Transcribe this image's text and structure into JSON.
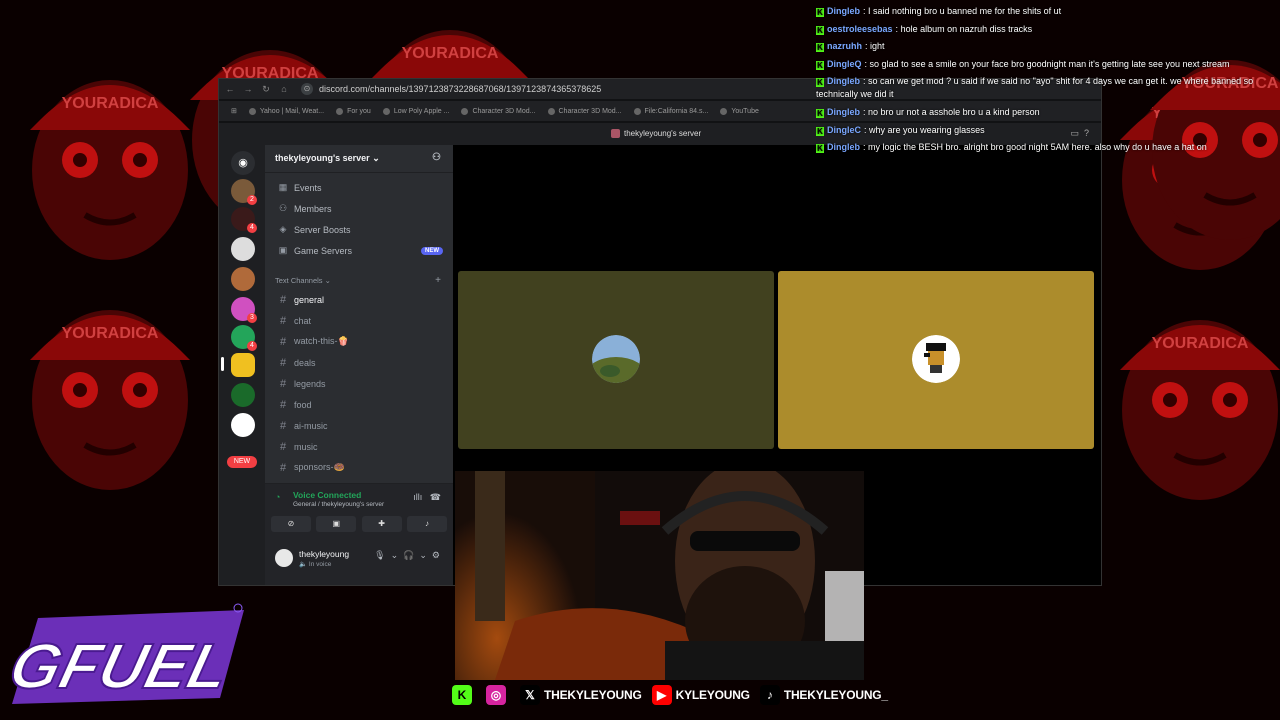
{
  "browser": {
    "url": "discord.com/channels/1397123873228687068/1397123874365378625",
    "bookmarks": [
      "Yahoo | Mail, Weat...",
      "For you",
      "Low Poly Apple ...",
      "Character 3D Mod...",
      "Character 3D Mod...",
      "File:California 84.s...",
      "YouTube"
    ]
  },
  "discord": {
    "top_title": "thekyleyoung's server",
    "server_name": "thekyleyoung's server",
    "menu": [
      {
        "label": "Events",
        "icon": "calendar-icon"
      },
      {
        "label": "Members",
        "icon": "members-icon"
      },
      {
        "label": "Server Boosts",
        "icon": "boost-icon"
      },
      {
        "label": "Game Servers",
        "icon": "game-icon",
        "tag": "NEW"
      }
    ],
    "category": "Text Channels",
    "channels": [
      "general",
      "chat",
      "watch-this-🍿",
      "deals",
      "legends",
      "food",
      "ai-music",
      "music",
      "sponsors-🍩"
    ],
    "active_channel": "general",
    "rail_badges": [
      "2",
      "4",
      "3",
      "4"
    ],
    "rail_new": "NEW",
    "voice": {
      "title": "Voice Connected",
      "subtitle": "General / thekyleyoung's server"
    },
    "user": {
      "name": "thekyleyoung",
      "status": "In voice"
    }
  },
  "colors": {
    "tile_left": "#41411f",
    "tile_right": "#ac8c2c",
    "kick_green": "#53fc18",
    "discord_blurple": "#5865f2"
  },
  "chat": [
    {
      "user": "Dingleb",
      "color": "#7aa7ff",
      "text": "I said nothing bro u banned me for the shits of ut"
    },
    {
      "user": "oestroleesebas",
      "color": "#7aa7ff",
      "text": "hole album on nazruh diss tracks"
    },
    {
      "user": "nazruhh",
      "color": "#7aa7ff",
      "text": "ight"
    },
    {
      "user": "DingleQ",
      "color": "#7aa7ff",
      "text": "so glad to see a smile on your face bro goodnight man it's getting late see you next stream"
    },
    {
      "user": "Dingleb",
      "color": "#7aa7ff",
      "text": "so can we get mod ? u said if we said no \"ayo\" shit for 4 days we can get it. we where banned so technically we did it",
      "wrap": true
    },
    {
      "user": "Dingleb",
      "color": "#7aa7ff",
      "text": "no bro ur not a asshole bro u a kind person"
    },
    {
      "user": "DingleC",
      "color": "#7aa7ff",
      "text": "why are you wearing glasses"
    },
    {
      "user": "Dingleb",
      "color": "#7aa7ff",
      "text": "my logic the BESH bro. alright bro good night 5AM here. also why do u have a hat on"
    }
  ],
  "socials": [
    {
      "platform": "kick-icon",
      "label": ""
    },
    {
      "platform": "instagram-icon",
      "label": ""
    },
    {
      "platform": "x-icon",
      "label": "THEKYLEYOUNG"
    },
    {
      "platform": "youtube-icon",
      "label": "KYLEYOUNG"
    },
    {
      "platform": "tiktok-icon",
      "label": "THEKYLEYOUNG_"
    }
  ],
  "overlay": {
    "hat_text": "YOURADICA",
    "sponsor": "GFUEL"
  }
}
